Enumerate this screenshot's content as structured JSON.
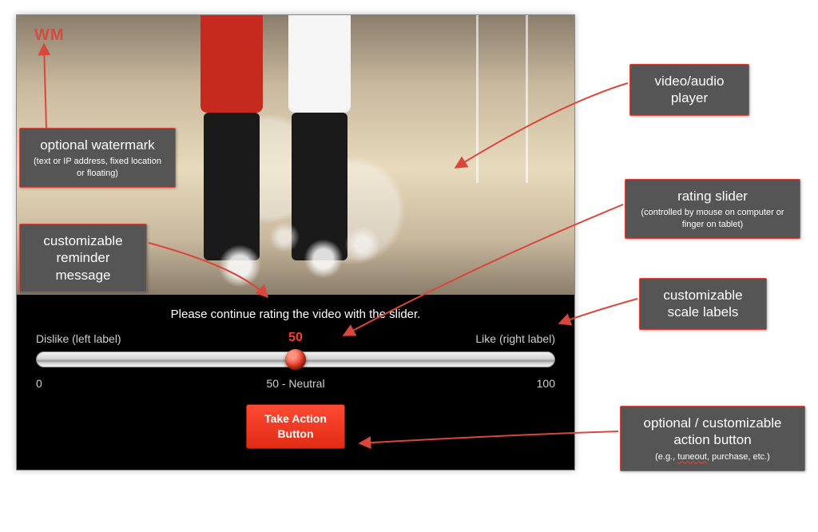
{
  "player": {
    "watermark_text": "WM",
    "reminder": "Please continue rating the video with the slider.",
    "scale": {
      "left_label": "Dislike (left label)",
      "right_label": "Like (right label)",
      "current_value": "50",
      "min_label": "0",
      "mid_label": "50 - Neutral",
      "max_label": "100"
    },
    "action_button": "Take Action\nButton"
  },
  "callouts": {
    "watermark": {
      "title": "optional watermark",
      "sub": "(text or IP address, fixed location or floating)"
    },
    "reminder": {
      "title": "customizable reminder message"
    },
    "player": {
      "title": "video/audio player"
    },
    "slider": {
      "title": "rating slider",
      "sub": "(controlled by mouse on computer or finger on tablet)"
    },
    "scale": {
      "title": "customizable scale labels"
    },
    "action": {
      "title": "optional / customizable action button",
      "sub": "(e.g., tuneout, purchase, etc.)"
    }
  }
}
